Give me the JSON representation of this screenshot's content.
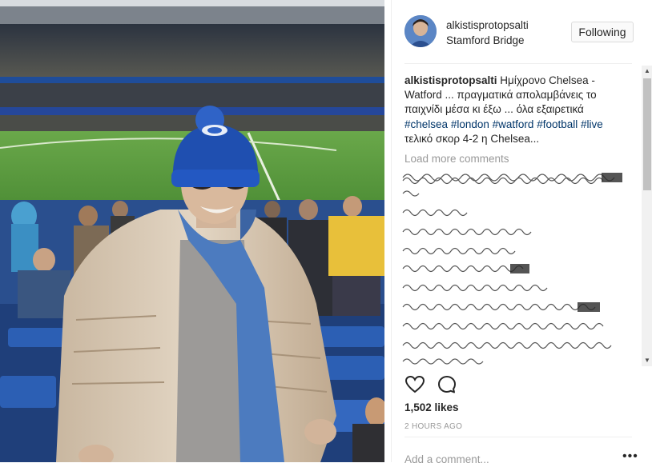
{
  "post": {
    "username": "alkistisprotopsalti",
    "location": "Stamford Bridge",
    "follow_label": "Following",
    "caption": {
      "user": "alkistisprotopsalti",
      "text_1": "Ημίχρονο Chelsea - Watford ... πραγματικά απολαμβάνεις το παιχνίδι μέσα κι έξω ... όλα εξαιρετικά",
      "tags": [
        "#chelsea",
        "#london",
        "#watford",
        "#football",
        "#live"
      ],
      "text_2": "τελικό σκορ 4-2 η Chelsea..."
    },
    "load_more": "Load more comments",
    "likes": "1,502 likes",
    "time": "2 HOURS AGO",
    "comment_placeholder": "Add a comment...",
    "more_options": "•••"
  },
  "icons": {
    "like": "heart-outline-icon",
    "comment": "speech-bubble-icon",
    "scroll_up": "triangle-up",
    "scroll_down": "triangle-down"
  },
  "colors": {
    "hashtag": "#003569",
    "secondary_text": "#999999",
    "border": "#dbdbdb",
    "text": "#262626"
  }
}
